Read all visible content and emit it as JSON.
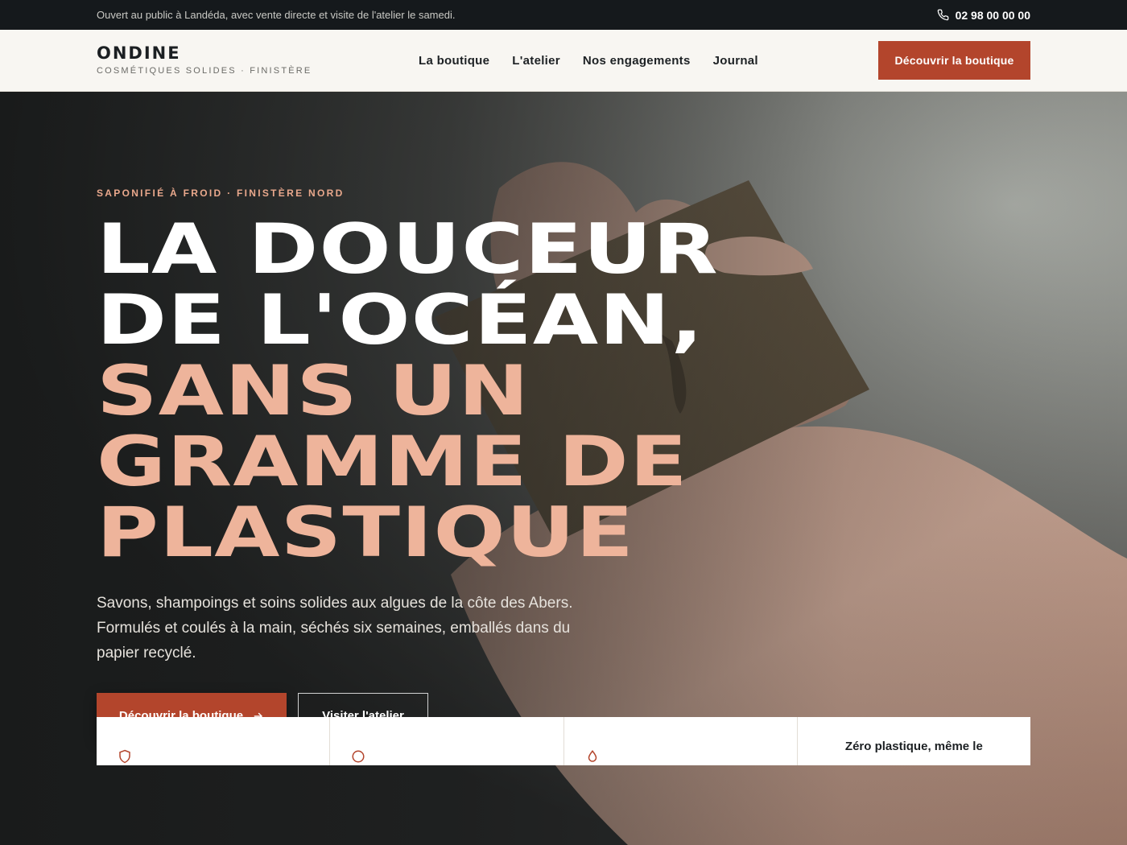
{
  "topbar": {
    "message": "Ouvert au public à Landéda, avec vente directe et visite de l'atelier le samedi.",
    "phone": "02 98 00 00 00",
    "phone_icon": "phone-icon"
  },
  "header": {
    "brand_name": "ONDINE",
    "brand_tagline": "COSMÉTIQUES SOLIDES · FINISTÈRE",
    "nav": [
      "La boutique",
      "L'atelier",
      "Nos engagements",
      "Journal"
    ],
    "cta_label": "Découvrir la boutique"
  },
  "hero": {
    "eyebrow": "SAPONIFIÉ À FROID · FINISTÈRE NORD",
    "headline_white": [
      "LA DOUCEUR",
      "DE L'OCÉAN,"
    ],
    "headline_accent": [
      "SANS UN",
      "GRAMME DE",
      "PLASTIQUE"
    ],
    "lead": "Savons, shampoings et soins solides aux algues de la côte des Abers. Formulés et coulés à la main, séchés six semaines, emballés dans du papier recyclé.",
    "primary_button": "Découvrir la boutique",
    "primary_icon": "arrow-right-icon",
    "secondary_button": "Visiter l'atelier",
    "image_alt": "hands-holding-soap-bar"
  },
  "features": [
    {
      "title": "",
      "icon": "shield-icon"
    },
    {
      "title": "",
      "icon": "leaf-icon"
    },
    {
      "title": "",
      "icon": "drop-icon"
    },
    {
      "title": "Zéro plastique, même le",
      "icon": ""
    }
  ],
  "colors": {
    "accent": "#b3452c",
    "headline_accent": "#eeb49b",
    "eyebrow": "#e9a88c",
    "topbar_bg": "#15191c",
    "header_bg": "#f8f6f2"
  }
}
